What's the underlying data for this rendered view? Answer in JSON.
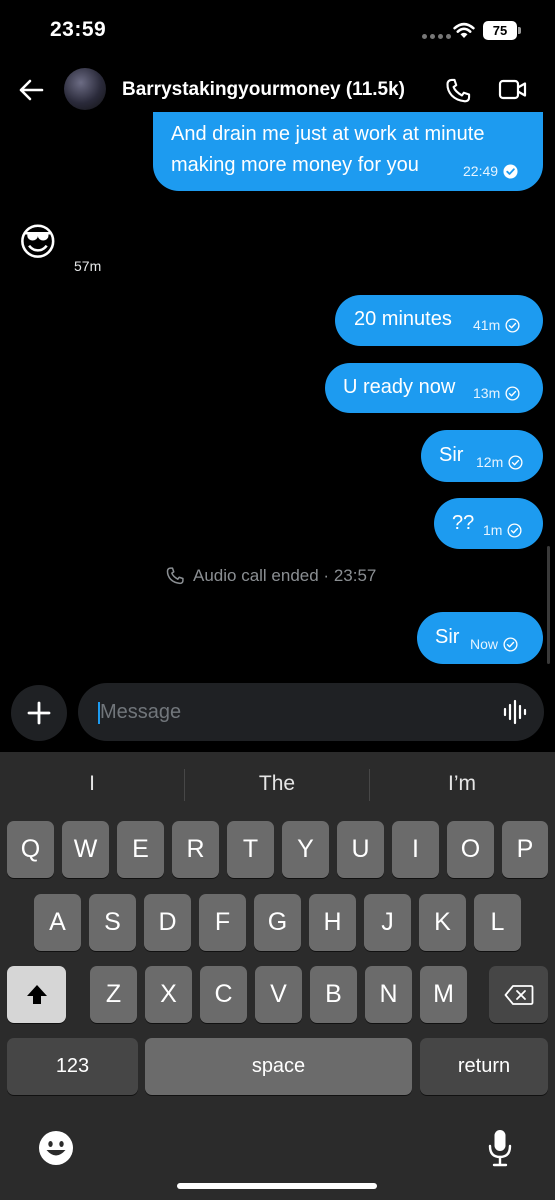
{
  "status_bar": {
    "time": "23:59",
    "battery": "75"
  },
  "header": {
    "contact_name": "Barrystakingyourmoney (11.5k)"
  },
  "messages": [
    {
      "text_line1": "And drain me just at work at minute",
      "text_line2": "making more money for you",
      "time": "22:49"
    },
    {
      "emoji": "😎",
      "time": "57m"
    },
    {
      "text": "20 minutes",
      "time": "41m"
    },
    {
      "text": "U ready now",
      "time": "13m"
    },
    {
      "text": "Sir",
      "time": "12m"
    },
    {
      "text": "??",
      "time": "1m"
    },
    {
      "event": "Audio call ended · 23:57"
    },
    {
      "text": "Sir",
      "time": "Now"
    }
  ],
  "composer": {
    "placeholder": "Message"
  },
  "keyboard": {
    "suggestions": [
      "I",
      "The",
      "I’m"
    ],
    "row1": [
      "Q",
      "W",
      "E",
      "R",
      "T",
      "Y",
      "U",
      "I",
      "O",
      "P"
    ],
    "row2": [
      "A",
      "S",
      "D",
      "F",
      "G",
      "H",
      "J",
      "K",
      "L"
    ],
    "row3": [
      "Z",
      "X",
      "C",
      "V",
      "B",
      "N",
      "M"
    ],
    "numbers_label": "123",
    "space_label": "space",
    "return_label": "return"
  },
  "colors": {
    "accent": "#1d9bf0",
    "background": "#000000",
    "keyboard_bg": "#2b2b2b",
    "key": "#6b6b6b"
  }
}
